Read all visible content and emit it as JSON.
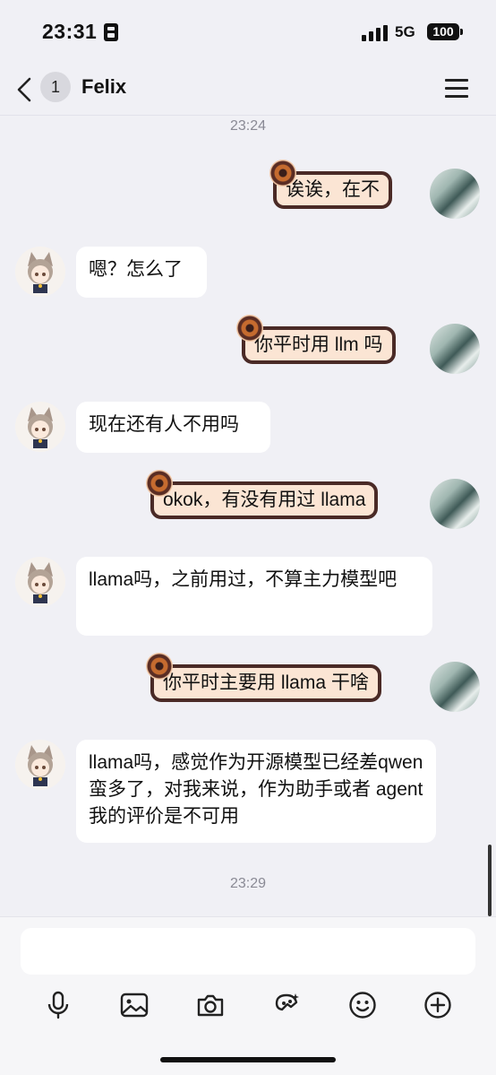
{
  "status_bar": {
    "time": "23:31",
    "network": "5G",
    "battery": "100"
  },
  "header": {
    "unread_count": "1",
    "title": "Felix"
  },
  "messages": [
    {
      "side": "right",
      "text": "诶诶，在不"
    },
    {
      "side": "left",
      "text": "嗯？怎么了"
    },
    {
      "side": "right",
      "text": "你平时用 llm 吗"
    },
    {
      "side": "left",
      "text": "现在还有人不用吗"
    },
    {
      "side": "right",
      "text": "okok，有没有用过 llama"
    },
    {
      "side": "left",
      "text": "llama吗，之前用过，不算主力模型吧"
    },
    {
      "side": "right",
      "text": "你平时主要用 llama 干啥"
    },
    {
      "side": "left",
      "text": "llama吗，感觉作为开源模型已经差qwen蛮多了，对我来说，作为助手或者 agent 我的评价是不可用"
    }
  ],
  "timestamps": [
    "23:24",
    "23:29"
  ],
  "input": {
    "placeholder": ""
  },
  "toolbar": {
    "items": [
      "microphone-icon",
      "image-icon",
      "camera-icon",
      "sticker-icon",
      "emoji-icon",
      "plus-icon"
    ]
  },
  "colors": {
    "background": "#f0f0f5",
    "bubble_right_fill": "#fbe5d4",
    "bubble_right_border": "#4a2a26",
    "bubble_left_fill": "#ffffff",
    "timestamp": "#8a8a95"
  }
}
